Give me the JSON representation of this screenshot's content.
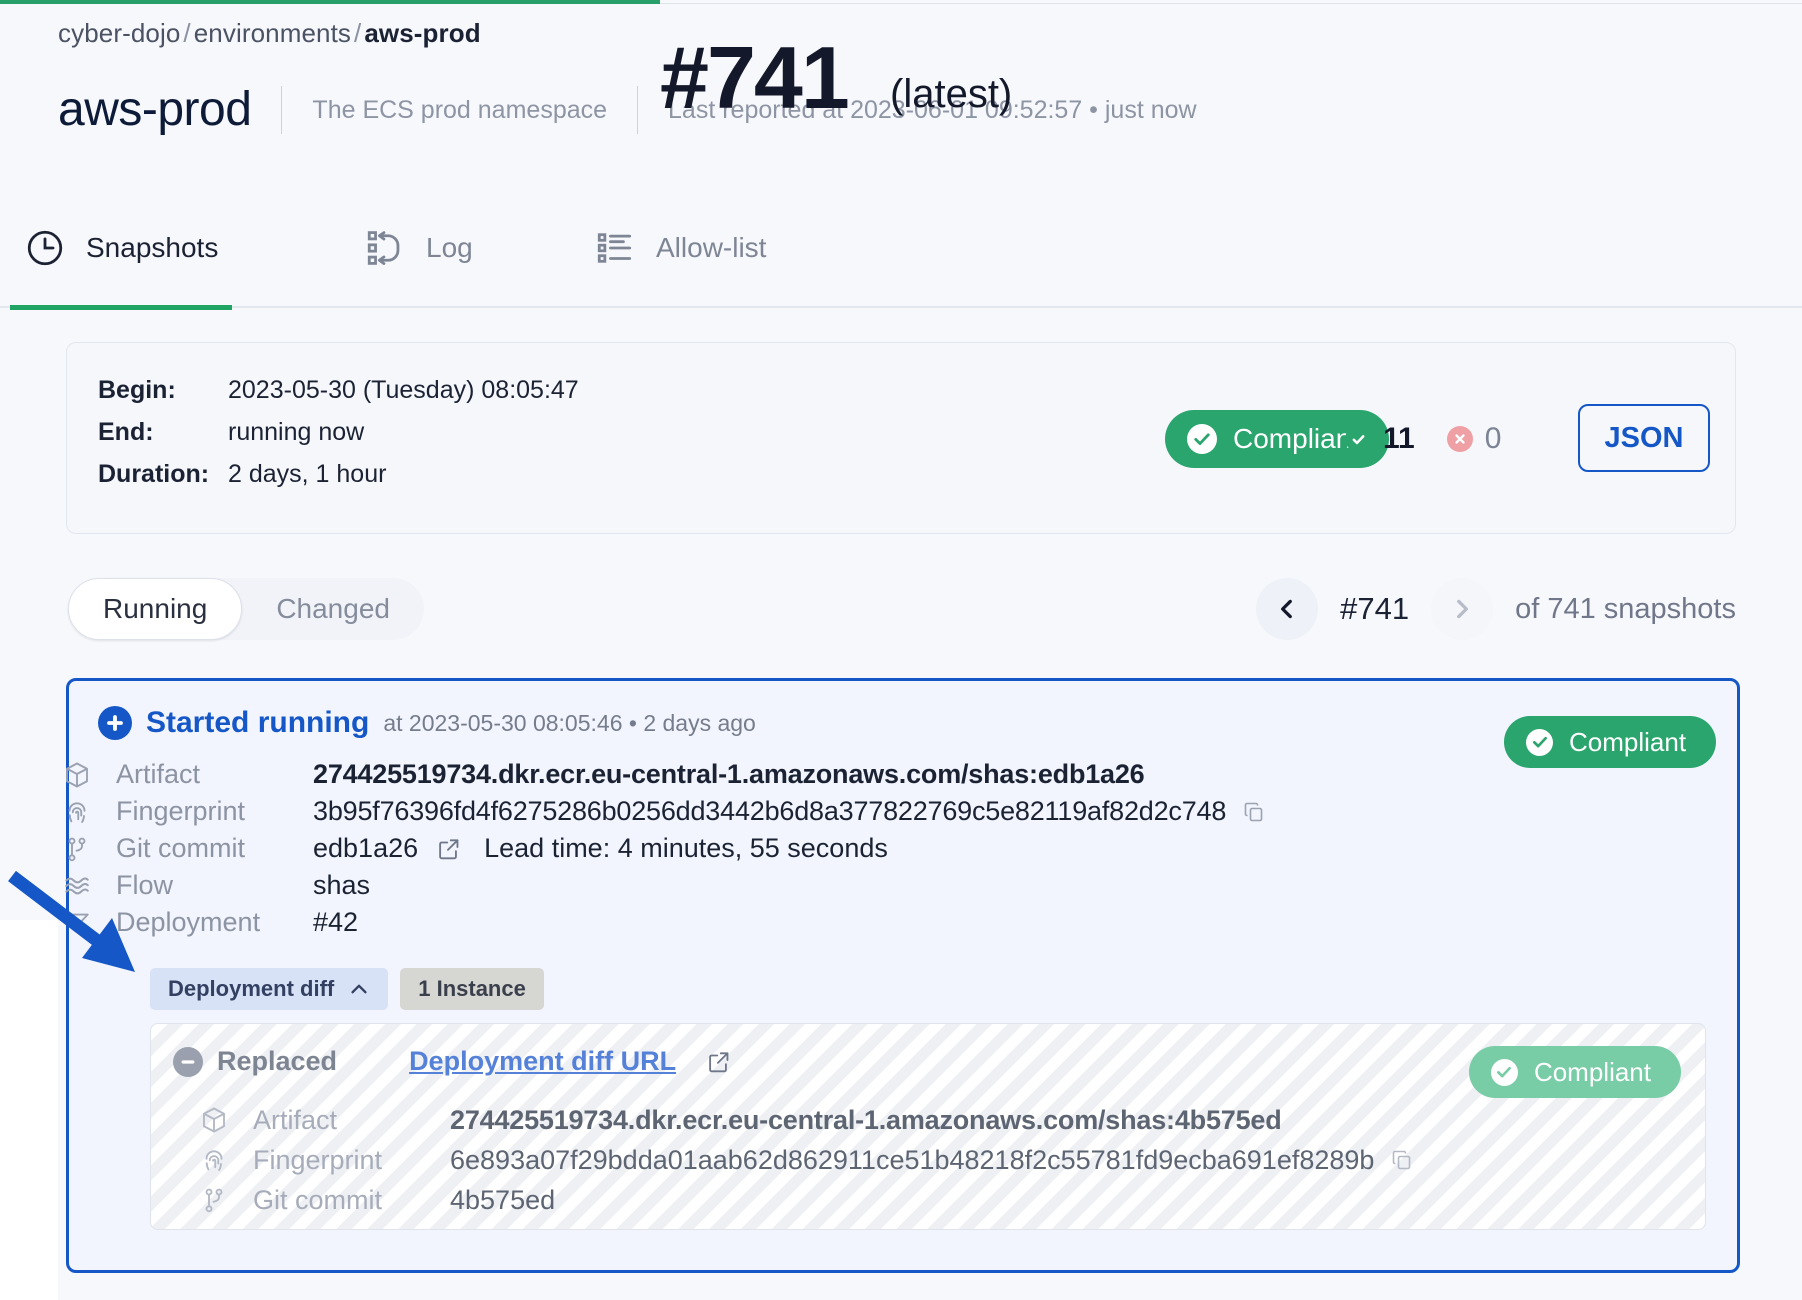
{
  "breadcrumb": {
    "items": [
      "cyber-dojo",
      "environments",
      "aws-prod"
    ],
    "separator": "/"
  },
  "header": {
    "title": "aws-prod",
    "description": "The ECS prod namespace",
    "reported": "Last reported at 2023-06-01 09:52:57 • just now"
  },
  "tabs": [
    {
      "label": "Snapshots",
      "icon": "clock-icon",
      "active": true
    },
    {
      "label": "Log",
      "icon": "log-icon",
      "active": false
    },
    {
      "label": "Allow-list",
      "icon": "list-icon",
      "active": false
    }
  ],
  "summary": {
    "begin_label": "Begin:",
    "begin_value": "2023-05-30 (Tuesday) 08:05:47",
    "end_label": "End:",
    "end_value": "running now",
    "duration_label": "Duration:",
    "duration_value": "2 days, 1 hour",
    "snapshot_number": "#741",
    "latest_label": "(latest)",
    "compliance_badge": "Compliant",
    "passed_count": "11",
    "failed_count": "0",
    "json_button": "JSON"
  },
  "filters": {
    "options": [
      "Running",
      "Changed"
    ],
    "selected": "Running"
  },
  "pager": {
    "prev_icon": "chevron-left-icon",
    "next_icon": "chevron-right-icon",
    "current": "#741",
    "total_text": "of 741 snapshots"
  },
  "event": {
    "title": "Started running",
    "subtitle": "at 2023-05-30 08:05:46 • 2 days ago",
    "badge": "Compliant",
    "rows": [
      {
        "icon": "cube-icon",
        "key": "Artifact",
        "value": "274425519734.dkr.ecr.eu-central-1.amazonaws.com/shas:edb1a26",
        "bold": true
      },
      {
        "icon": "fingerprint-icon",
        "key": "Fingerprint",
        "value": "3b95f76396fd4f6275286b0256dd3442b6d8a377822769c5e82119af82d2c748",
        "copy": true
      },
      {
        "icon": "git-commit-icon",
        "key": "Git commit",
        "value": "edb1a26",
        "external": true,
        "extra": "Lead time: 4 minutes, 55 seconds"
      },
      {
        "icon": "flow-icon",
        "key": "Flow",
        "value": "shas"
      },
      {
        "icon": "deployment-icon",
        "key": "Deployment",
        "value": "#42"
      }
    ],
    "chips": [
      {
        "label": "Deployment diff",
        "icon": "chevron-up-icon"
      },
      {
        "label": "1 Instance"
      }
    ],
    "diff_panel": {
      "status": "Replaced",
      "link": "Deployment diff URL",
      "badge": "Compliant",
      "rows": [
        {
          "icon": "cube-icon",
          "key": "Artifact",
          "value": "274425519734.dkr.ecr.eu-central-1.amazonaws.com/shas:4b575ed",
          "bold": true
        },
        {
          "icon": "fingerprint-icon",
          "key": "Fingerprint",
          "value": "6e893a07f29bdda01aab62d862911ce51b48218f2c55781fd9ecba691ef8289b",
          "copy": true
        },
        {
          "icon": "git-commit-icon",
          "key": "Git commit",
          "value": "4b575ed"
        }
      ]
    }
  },
  "colors": {
    "accent_blue": "#1557c7",
    "compliant_green": "#2ba56e",
    "compliant_green_soft": "#78cda6",
    "fail_red": "#efa0a4",
    "tab_underline": "#1fa463"
  }
}
